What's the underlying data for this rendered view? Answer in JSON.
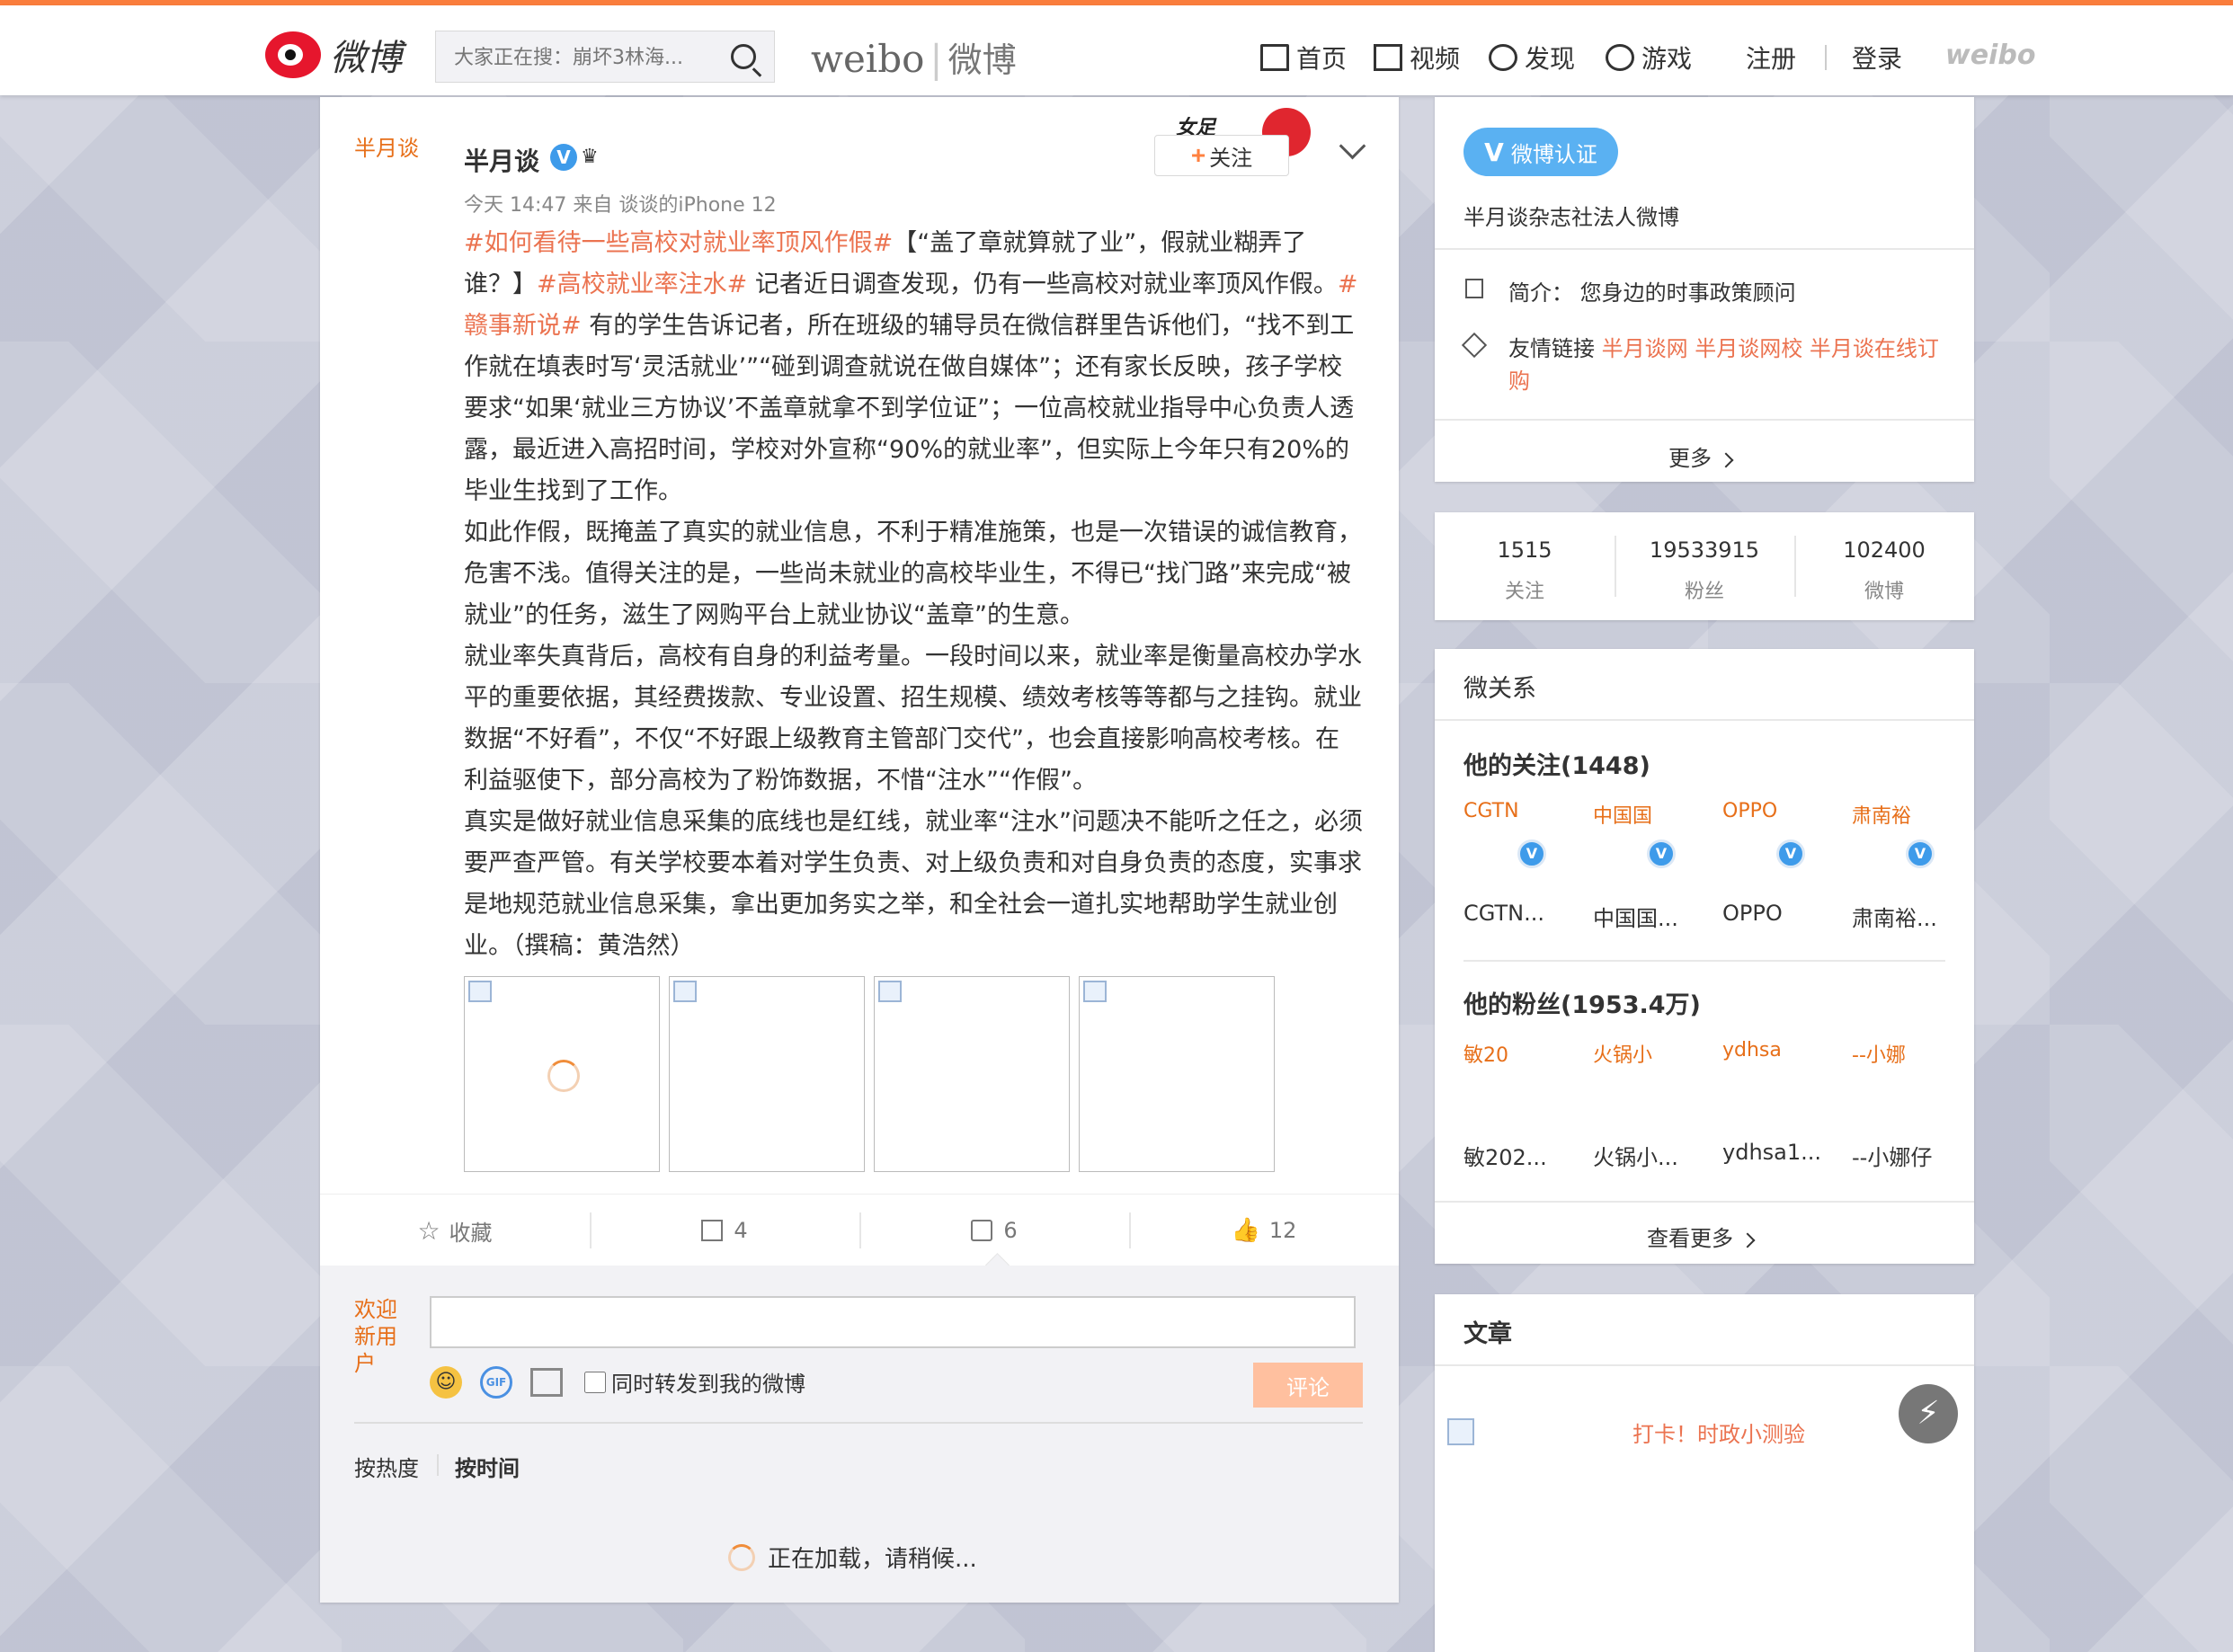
{
  "header": {
    "logo_text": "微博",
    "search_placeholder": "大家正在搜：崩坏3林海...",
    "brand_en": "weibo",
    "brand_cn": "微博",
    "nav": [
      {
        "label": "首页",
        "icon": "home-icon"
      },
      {
        "label": "视频",
        "icon": "video-icon"
      },
      {
        "label": "发现",
        "icon": "compass-icon"
      },
      {
        "label": "游戏",
        "icon": "gamepad-icon"
      }
    ],
    "register": "注册",
    "login": "登录",
    "weibo_mark": "weibo"
  },
  "post": {
    "avatar_alt": "半月谈",
    "author": "半月谈",
    "time_source": "今天 14:47 来自 谈谈的iPhone 12",
    "follow_label": "关注",
    "badge_text": "女足",
    "paragraphs": [
      [
        "#如何看待一些高校对就业率顶风作假#",
        "【“盖了章就算就了业”，假就业糊弄了谁？】",
        "#高校就业率注水#",
        " 记者近日调查发现，仍有一些高校对就业率顶风作假。",
        "#赣事新说#",
        " 有的学生告诉记者，所在班级的辅导员在微信群里告诉他们，“找不到工作就在填表时写‘灵活就业’”“碰到调查就说在做自媒体”；还有家长反映，孩子学校要求“如果‘就业三方协议’不盖章就拿不到学位证”；一位高校就业指导中心负责人透露，最近进入高招时间，学校对外宣称“90%的就业率”，但实际上今年只有20%的毕业生找到了工作。"
      ],
      "如此作假，既掩盖了真实的就业信息，不利于精准施策，也是一次错误的诚信教育，危害不浅。值得关注的是，一些尚未就业的高校毕业生，不得已“找门路”来完成“被就业”的任务，滋生了网购平台上就业协议“盖章”的生意。",
      "就业率失真背后，高校有自身的利益考量。一段时间以来，就业率是衡量高校办学水平的重要依据，其经费拨款、专业设置、招生规模、绩效考核等等都与之挂钩。就业数据“不好看”，不仅“不好跟上级教育主管部门交代”，也会直接影响高校考核。在利益驱使下，部分高校为了粉饰数据，不惜“注水”“作假”。",
      "真实是做好就业信息采集的底线也是红线，就业率“注水”问题决不能听之任之，必须要严查严管。有关学校要本着对学生负责、对上级负责和对自身负责的态度，实事求是地规范就业信息采集，拿出更加务实之举，和全社会一道扎实地帮助学生就业创业。（撰稿：黄浩然）"
    ],
    "actions": [
      {
        "label": "收藏",
        "icon": "star-icon"
      },
      {
        "label": "4",
        "icon": "share-icon"
      },
      {
        "label": "6",
        "icon": "comment-icon"
      },
      {
        "label": "12",
        "icon": "like-icon"
      }
    ],
    "commenter_alt": "欢迎新用户",
    "repost_checkbox": "同时转发到我的微博",
    "comment_button": "评论",
    "sort_hot": "按热度",
    "sort_time": "按时间",
    "loading": "正在加载，请稍候..."
  },
  "profile": {
    "verify_label": "微博认证",
    "verify_desc": "半月谈杂志社法人微博",
    "intro_label": "简介：",
    "intro_value": "您身边的时事政策顾问",
    "links_label": "友情链接",
    "links_line1": "半月谈网 半月谈网校 半月谈在线订",
    "links_line2": "购",
    "more": "更多"
  },
  "stats": [
    {
      "num": "1515",
      "label": "关注"
    },
    {
      "num": "19533915",
      "label": "粉丝"
    },
    {
      "num": "102400",
      "label": "微博"
    }
  ],
  "relations": {
    "title": "微关系",
    "following_title": "他的关注(1448)",
    "following": [
      {
        "alt": "CGTN",
        "name": "CGTN..."
      },
      {
        "alt": "中国国",
        "name": "中国国..."
      },
      {
        "alt": "OPPO",
        "name": "OPPO"
      },
      {
        "alt": "肃南裕",
        "name": "肃南裕..."
      }
    ],
    "fans_title": "他的粉丝(1953.4万)",
    "fans": [
      {
        "alt": "敏20",
        "name": "敏202..."
      },
      {
        "alt": "火锅小",
        "name": "火锅小..."
      },
      {
        "alt": "ydhsa",
        "name": "ydhsa1..."
      },
      {
        "alt": "--小娜",
        "name": "--小娜仔"
      }
    ],
    "more": "查看更多"
  },
  "articles": {
    "title": "文章",
    "item": "打卡！时政小测验"
  },
  "colors": {
    "accent": "#fa7d3c",
    "topic": "#eb7350",
    "verify": "#3e9bea"
  }
}
